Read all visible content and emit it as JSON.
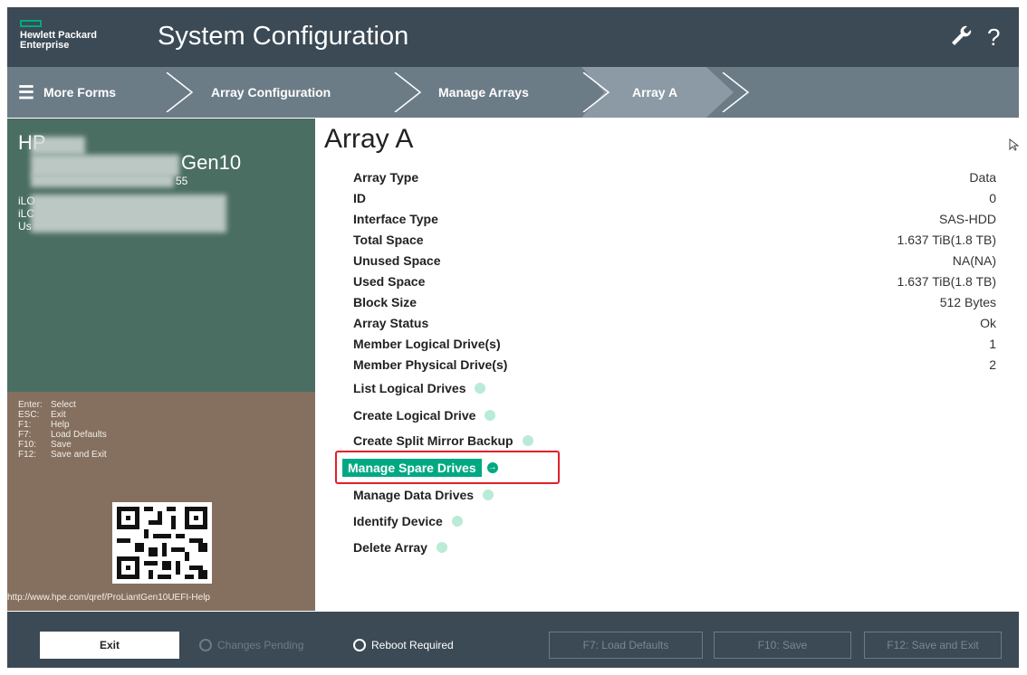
{
  "brand": {
    "line1": "Hewlett Packard",
    "line2": "Enterprise"
  },
  "header": {
    "title": "System Configuration",
    "wrench_icon": "wrench-icon",
    "help_icon": "?"
  },
  "nav": {
    "menu_label": "More Forms",
    "breadcrumbs": [
      "Array Configuration",
      "Manage Arrays",
      "Array A"
    ]
  },
  "sysinfo": {
    "line1": "HP",
    "line2_suffix": "Gen10",
    "serial_suffix": "55",
    "ilo1": "iLO",
    "ilo2": "iLC",
    "user": "Us"
  },
  "keys": [
    {
      "key": "Enter:",
      "action": "Select"
    },
    {
      "key": "ESC:",
      "action": "Exit"
    },
    {
      "key": "F1:",
      "action": "Help"
    },
    {
      "key": "F7:",
      "action": "Load Defaults"
    },
    {
      "key": "F10:",
      "action": "Save"
    },
    {
      "key": "F12:",
      "action": "Save and Exit"
    }
  ],
  "help_url": "http://www.hpe.com/qref/ProLiantGen10UEFI-Help",
  "main": {
    "title": "Array A",
    "properties": [
      {
        "label": "Array Type",
        "value": "Data"
      },
      {
        "label": "ID",
        "value": "0"
      },
      {
        "label": "Interface Type",
        "value": "SAS-HDD"
      },
      {
        "label": "Total Space",
        "value": "1.637 TiB(1.8 TB)"
      },
      {
        "label": "Unused Space",
        "value": "NA(NA)"
      },
      {
        "label": "Used Space",
        "value": "1.637 TiB(1.8 TB)"
      },
      {
        "label": "Block Size",
        "value": "512 Bytes"
      },
      {
        "label": "Array Status",
        "value": "Ok"
      },
      {
        "label": "Member Logical Drive(s)",
        "value": "1"
      },
      {
        "label": "Member Physical Drive(s)",
        "value": "2"
      }
    ],
    "actions": [
      "List Logical Drives",
      "Create Logical Drive",
      "Create Split Mirror Backup",
      "Manage Spare Drives",
      "Manage Data Drives",
      "Identify Device",
      "Delete Array"
    ],
    "selected_action": "Manage Spare Drives"
  },
  "footer": {
    "exit": "Exit",
    "changes_pending": "Changes Pending",
    "reboot_required": "Reboot Required",
    "load_defaults": "F7: Load Defaults",
    "save": "F10: Save",
    "save_exit": "F12: Save and Exit"
  },
  "colors": {
    "accent": "#01a982",
    "header": "#3b4a55",
    "highlight": "#e3202a"
  }
}
